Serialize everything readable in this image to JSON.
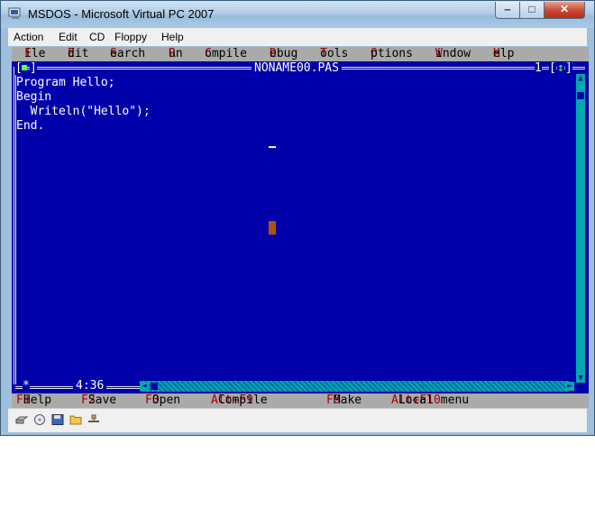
{
  "window": {
    "title": "MSDOS - Microsoft Virtual PC 2007",
    "min_glyph": "‒",
    "max_glyph": "□",
    "close_glyph": "✕"
  },
  "host_menu": [
    {
      "label": "Action"
    },
    {
      "label": "Edit"
    },
    {
      "label": "CD"
    },
    {
      "label": "Floppy"
    },
    {
      "label": "Help"
    }
  ],
  "ide_menu": [
    {
      "hot": "F",
      "rest": "ile"
    },
    {
      "hot": "E",
      "rest": "dit"
    },
    {
      "hot": "S",
      "rest": "earch"
    },
    {
      "hot": "R",
      "rest": "un"
    },
    {
      "hot": "C",
      "rest": "ompile"
    },
    {
      "hot": "D",
      "rest": "ebug"
    },
    {
      "hot": "T",
      "rest": "ools"
    },
    {
      "hot": "O",
      "rest": "ptions"
    },
    {
      "hot": "W",
      "rest": "indow"
    },
    {
      "hot": "H",
      "rest": "elp"
    }
  ],
  "editor": {
    "filename": "NONAME00.PAS",
    "window_number": "1",
    "left_bracket": "[",
    "right_bracket": "]",
    "close_box_glyph": "■",
    "zoom_glyph": "↕",
    "code_lines": [
      "Program Hello;",
      "Begin",
      "  Writeln(\"Hello\");",
      "End."
    ],
    "cursor_position": "4:36",
    "modified_marker": "*"
  },
  "help_bar": [
    {
      "key": "F1",
      "label": "Help"
    },
    {
      "key": "F2",
      "label": "Save"
    },
    {
      "key": "F3",
      "label": "Open"
    },
    {
      "key": "Alt+F9",
      "label": "Compile"
    },
    {
      "key": "F9",
      "label": "Make"
    },
    {
      "key": "Alt+F10",
      "label": "Local menu"
    }
  ],
  "colors": {
    "editor_bg": "#0000aa",
    "menu_bg": "#aaaaaa",
    "hotkey": "#aa0000",
    "scrollbar": "#00aaaa"
  },
  "status_icons": [
    "hard-disk-icon",
    "cd-drive-icon",
    "floppy-icon",
    "shared-folder-icon",
    "network-icon"
  ]
}
